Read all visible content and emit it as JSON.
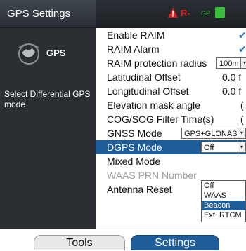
{
  "sidebar": {
    "title": "GPS Settings",
    "gps_label": "GPS",
    "description": "Select Differential GPS mode"
  },
  "status": {
    "r_text": "R-",
    "gp_text": "GP"
  },
  "settings": {
    "enable_raim": "Enable RAIM",
    "raim_alarm": "RAIM Alarm",
    "raim_radius_label": "RAIM protection radius",
    "raim_radius_value": "100m",
    "lat_offset_label": "Latitudinal Offset",
    "lat_offset_value": "0.0 f",
    "lon_offset_label": "Longitudinal Offset",
    "lon_offset_value": "0.0 f",
    "elevation_label": "Elevation mask angle",
    "elevation_value": "(",
    "cog_label": "COG/SOG Filter Time(s)",
    "cog_value": "(",
    "gnss_label": "GNSS Mode",
    "gnss_value": "GPS+GLONASS",
    "dgps_label": "DGPS Mode",
    "dgps_value": "Off",
    "mixed_label": "Mixed Mode",
    "waas_label": "WAAS PRN Number",
    "reset_label": "Antenna Reset",
    "check_glyph": "✔"
  },
  "dgps_options": [
    "Off",
    "WAAS",
    "Beacon",
    "Ext. RTCM"
  ],
  "tabs": {
    "tools": "Tools",
    "settings": "Settings"
  },
  "colors": {
    "accent": "#1f5d99",
    "alarm": "#d61c1c",
    "ok": "#3dbb3d",
    "sidebar_bg": "#2b2f33"
  }
}
